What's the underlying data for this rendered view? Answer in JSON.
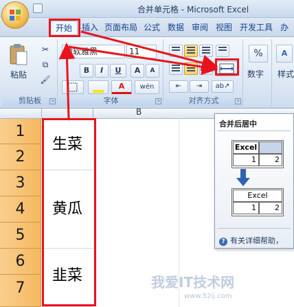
{
  "window": {
    "title": "合并单元格 - Microsoft Excel"
  },
  "tabs": [
    "开始",
    "插入",
    "页面布局",
    "公式",
    "数据",
    "审阅",
    "视图",
    "开发工具",
    "办"
  ],
  "ribbon": {
    "clipboard": {
      "label": "剪贴板",
      "paste_label": "粘贴"
    },
    "font": {
      "label": "字体",
      "font_name": "微软雅黑",
      "font_size": "11"
    },
    "alignment": {
      "label": "对齐方式"
    },
    "number": {
      "label": "数字"
    },
    "styles": {
      "label": "样式"
    }
  },
  "sheet": {
    "col_b": "B",
    "rows": [
      "1",
      "2",
      "3",
      "4",
      "5",
      "6",
      "7"
    ],
    "merged": [
      "生菜",
      "黄瓜",
      "韭菜"
    ]
  },
  "tooltip": {
    "title": "合并后居中",
    "before_label": "Excel",
    "after_label": "Excel",
    "val1": "1",
    "val2": "2",
    "help": "有关详细帮助，"
  },
  "watermark": {
    "main": "我爱IT技术网",
    "url": "www.52ij.com"
  },
  "colors": {
    "annotation": "#e8141c",
    "row_header": "#f6b85e"
  }
}
